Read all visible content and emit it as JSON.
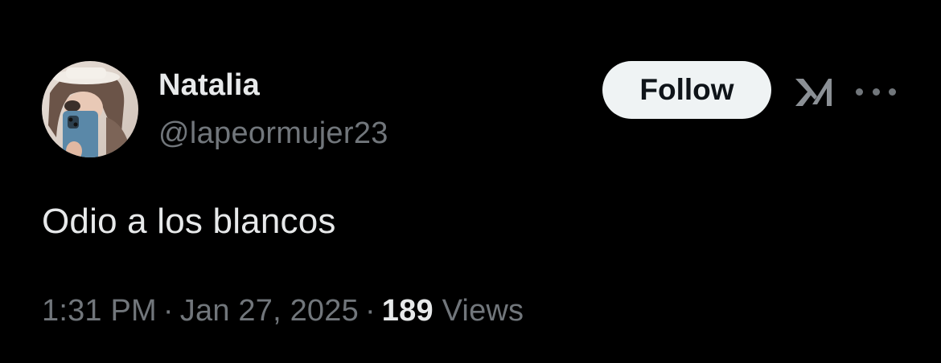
{
  "tweet": {
    "author": {
      "display_name": "Natalia",
      "handle": "@lapeormujer23"
    },
    "follow_label": "Follow",
    "text": "Odio a los blancos",
    "time": "1:31 PM",
    "separator": "·",
    "date": "Jan 27, 2025",
    "views_count": "189",
    "views_label": "Views"
  },
  "icons": {
    "logo": "x-grok-logo-icon",
    "more": "more-horizontal-icon"
  },
  "colors": {
    "background": "#000000",
    "primary_text": "#e7e9ea",
    "secondary_text": "#71767b",
    "follow_button_bg": "#eff3f4",
    "follow_button_text": "#0f1419"
  }
}
